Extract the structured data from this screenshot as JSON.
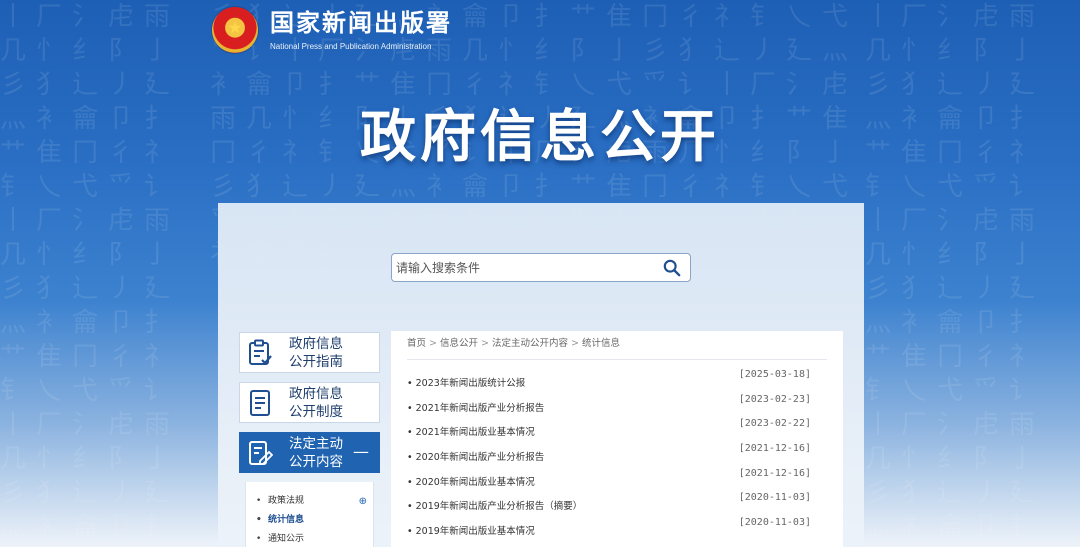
{
  "site": {
    "name_cn": "国家新闻出版署",
    "name_en": "National Press and Publication Administration"
  },
  "hero": {
    "title": "政府信息公开"
  },
  "search": {
    "placeholder": "请输入搜索条件",
    "icon": "search-icon"
  },
  "sidebar": {
    "items": [
      {
        "line1": "政府信息",
        "line2": "公开指南",
        "icon": "clipboard-check-icon"
      },
      {
        "line1": "政府信息",
        "line2": "公开制度",
        "icon": "document-icon"
      },
      {
        "line1": "法定主动",
        "line2": "公开内容",
        "icon": "edit-document-icon",
        "active": true,
        "toggle": "—"
      }
    ],
    "submenu": [
      {
        "label": "政策法规",
        "has_plus": true,
        "plus": "⊕"
      },
      {
        "label": "统计信息",
        "current": true
      },
      {
        "label": "通知公示"
      }
    ]
  },
  "breadcrumb": [
    "首页",
    "信息公开",
    "法定主动公开内容",
    "统计信息"
  ],
  "breadcrumb_sep": ">",
  "list": [
    {
      "title": "2023年新闻出版统计公报",
      "date": "[2025-03-18]"
    },
    {
      "title": "2021年新闻出版产业分析报告",
      "date": "[2023-02-23]"
    },
    {
      "title": "2021年新闻出版业基本情况",
      "date": "[2023-02-22]"
    },
    {
      "title": "2020年新闻出版产业分析报告",
      "date": "[2021-12-16]"
    },
    {
      "title": "2020年新闻出版业基本情况",
      "date": "[2021-12-16]"
    },
    {
      "title": "2019年新闻出版产业分析报告（摘要）",
      "date": "[2020-11-03]"
    },
    {
      "title": "2019年新闻出版业基本情况",
      "date": "[2020-11-03]"
    }
  ],
  "colors": {
    "primary": "#2063b0",
    "hero_bg": "#2a6fc4",
    "text": "#333333"
  }
}
